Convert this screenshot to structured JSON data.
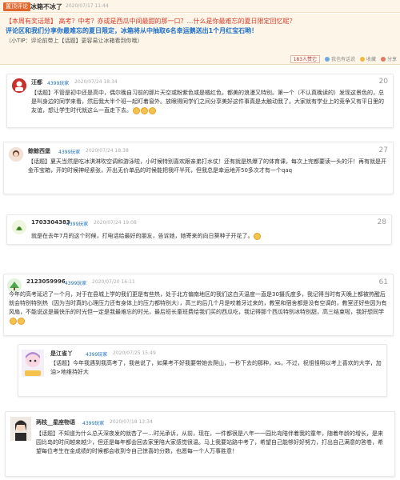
{
  "header": {
    "tag_label": "置顶评论",
    "title": "冰箱不冰了",
    "date": "2020/07/17 11:44"
  },
  "topic": {
    "line1": "【本周有奖话题】 高考？中考？亦或是西瓜中间最甜的那一口？…什么是你最难忘的夏日限定回忆呢？",
    "line2": "评论区和我们分享你最难忘的夏日限定，冰箱将从中抽取6名幸运鹅送出1个月红宝石哟！",
    "line3": "（小TIP：评论前带上【话题】更容易让冰箱看到你哦）"
  },
  "actions": {
    "like_count": "183人赞它",
    "reply": "我也有话说",
    "collect": "收藏",
    "share": "分享"
  },
  "comments": [
    {
      "name": "汪都",
      "source": "4399玩家",
      "date": "2020/07/24 18:34",
      "floor": "20",
      "text": "【话题】不管是初中还是高中，偶尔晚自习前的那片天空或粉紫色或是橘红色，都美的浪漫又特别。第一个（不认真晚读的）发现这景色的，总是叫身边的同学来看，然后我大半个班一起盯着窗外。放眼得同学们之间分享美好这件事真是太触动我了。大家就有学业上的竞争又有平日里的友谊，想让学生时代就这么一直走下去。"
    },
    {
      "name": "鲸鲸西堡",
      "source": "4399玩家",
      "date": "2020/07/24 18:38",
      "floor": "27",
      "text": "【话题】夏天当然是吃冰淇淋吹空调和游泳啦，小时候特别喜欢跟亲弟打水仗！还有就是热爆了的体育课，每次上完都要读一头的汗！再有就是开金币宝箱，开的时候神经紧张，开出无价单品的时候能把我吓半死，但我总是幸运地开50多次才有一个qaq"
    },
    {
      "name": "1703304383",
      "source": "4399玩家",
      "date": "2020/07/24 19:08",
      "floor": "28",
      "text": "就是在去年7月的这个时候，打电话给最好的朋友，告诉她，她寄来的向日葵种子开花了。"
    },
    {
      "name": "2123059996",
      "source": "4399玩家",
      "date": "2020/07/20 16:11",
      "floor": "61",
      "text": "今年的高考延迟了一个月，对于在县城上学的我们更是有些热，处于北方偏南地区的我们这白天温度一直是30摄氏度多，我记得当时有天晚上都被热醒后就会特别特别热（因为当时真的心理压力还有身体上的压力都特别大），高三的后几个月是咬着牙过来的，教室和宿舍都是没有空调的，教室还好些因为有风扇，不能说这是最快乐的时光但一定是我最难忘的时光，最后班长童班费给我们买的西瓜吃，我记得那个西瓜特别冰特别甜，高三结束啦，我好想同学"
    },
    {
      "name": "是江雀丫",
      "source": "4399玩家",
      "date": "2020/07/25 15:49",
      "floor": "",
      "text": "【话题】今年我遇到我高考了，我爸说了，如果考不好我要带她去爬山，一秒下去的那种，xs，不过，祝祖祖明以考上喜欢的大学，加油>地维持好大"
    },
    {
      "name": "两枝__星座物语",
      "source": "4399玩家",
      "date": "2020/07/18 13:34",
      "floor": "",
      "text": "【话题】不知道为什么总天深夜发的就杏了一…时光承诉，从前，现在，一件都很是八年一一园比岛陪伴着我的童年，随着年龄的增长，是来园比岛的时间越来越少，但还是每年都会回去家里陪大家感觉很温。马上我要站路中考了，希望自己能够好好努力，打出自己满意的答卷，希望每位考生在金成绩的时候都会收到令自己惊喜的分数，也愿每一个人万事胜意！"
    }
  ],
  "colors": {
    "tag_bg": "#e0672e",
    "topic_red": "#d63b2a",
    "topic_blue": "#1e6fc8",
    "header_bg": "#fdf6e8"
  }
}
